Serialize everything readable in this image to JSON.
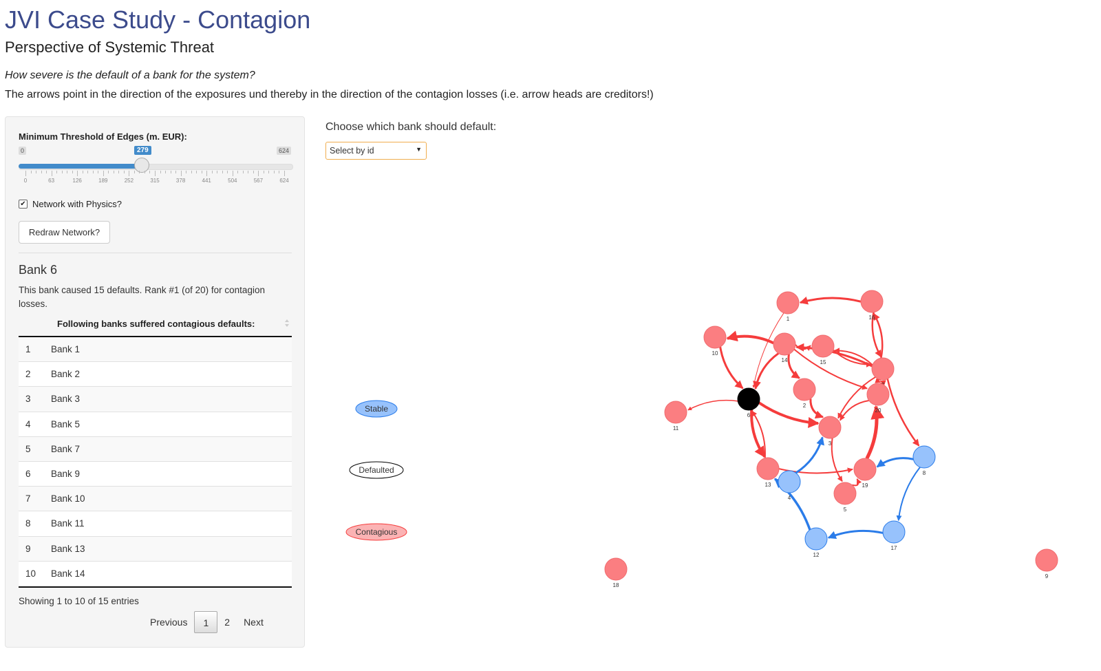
{
  "header": {
    "title": "JVI Case Study - Contagion",
    "subtitle": "Perspective of Systemic Threat",
    "question": "How severe is the default of a bank for the system?",
    "explanation": "The arrows point in the direction of the exposures und thereby in the direction of the contagion losses (i.e. arrow heads are creditors!)"
  },
  "sidebar": {
    "slider": {
      "label": "Minimum Threshold of Edges (m. EUR):",
      "min_label": "0",
      "max_label": "624",
      "value_label": "279",
      "value_fraction": 0.447,
      "tick_labels": [
        "0",
        "63",
        "126",
        "189",
        "252",
        "315",
        "378",
        "441",
        "504",
        "567",
        "624"
      ]
    },
    "physics_checkbox": {
      "label": "Network with Physics?",
      "checked": true,
      "check_glyph": "✔"
    },
    "redraw_button": "Redraw Network?",
    "bank_title": "Bank 6",
    "bank_description": "This bank caused 15 defaults. Rank #1 (of 20) for contagion losses.",
    "table": {
      "header": "Following banks suffered contagious defaults:",
      "rows": [
        {
          "n": "1",
          "name": "Bank 1"
        },
        {
          "n": "2",
          "name": "Bank 2"
        },
        {
          "n": "3",
          "name": "Bank 3"
        },
        {
          "n": "4",
          "name": "Bank 5"
        },
        {
          "n": "5",
          "name": "Bank 7"
        },
        {
          "n": "6",
          "name": "Bank 9"
        },
        {
          "n": "7",
          "name": "Bank 10"
        },
        {
          "n": "8",
          "name": "Bank 11"
        },
        {
          "n": "9",
          "name": "Bank 13"
        },
        {
          "n": "10",
          "name": "Bank 14"
        }
      ],
      "info": "Showing 1 to 10 of 15 entries",
      "pager": {
        "previous": "Previous",
        "page1": "1",
        "page2": "2",
        "next": "Next"
      }
    }
  },
  "main": {
    "choose_label": "Choose which bank should default:",
    "select_value": "Select by id",
    "select_caret": "▼"
  },
  "network": {
    "colors": {
      "stable": "#97c2fc",
      "stable_border": "#2b7ce9",
      "contagious": "#fb7e81",
      "contagious_edge": "#f53c3c",
      "stable_edge": "#2b7ce9",
      "defaulted": "#000000"
    },
    "legend": {
      "stable": "Stable",
      "defaulted": "Defaulted",
      "contagious": "Contagious"
    },
    "nodes": [
      {
        "id": "1",
        "label": "1",
        "group": "contagious"
      },
      {
        "id": "16",
        "label": "16",
        "group": "contagious"
      },
      {
        "id": "10",
        "label": "10",
        "group": "contagious"
      },
      {
        "id": "14",
        "label": "14",
        "group": "contagious"
      },
      {
        "id": "15",
        "label": "15",
        "group": "contagious"
      },
      {
        "id": "7",
        "label": "7",
        "group": "contagious"
      },
      {
        "id": "2",
        "label": "2",
        "group": "contagious"
      },
      {
        "id": "20",
        "label": "20",
        "group": "contagious"
      },
      {
        "id": "6",
        "label": "6",
        "group": "defaulted"
      },
      {
        "id": "11",
        "label": "11",
        "group": "contagious"
      },
      {
        "id": "3",
        "label": "3",
        "group": "contagious"
      },
      {
        "id": "13",
        "label": "13",
        "group": "contagious"
      },
      {
        "id": "4",
        "label": "4",
        "group": "stable"
      },
      {
        "id": "19",
        "label": "19",
        "group": "contagious"
      },
      {
        "id": "8",
        "label": "8",
        "group": "stable"
      },
      {
        "id": "5",
        "label": "5",
        "group": "contagious"
      },
      {
        "id": "12",
        "label": "12",
        "group": "stable"
      },
      {
        "id": "17",
        "label": "17",
        "group": "stable"
      },
      {
        "id": "18",
        "label": "18",
        "group": "contagious"
      },
      {
        "id": "9",
        "label": "9",
        "group": "contagious"
      }
    ],
    "edges": [
      {
        "from": "16",
        "to": "1",
        "w": 3
      },
      {
        "from": "14",
        "to": "10",
        "w": 4
      },
      {
        "from": "1",
        "to": "6",
        "w": 1
      },
      {
        "from": "10",
        "to": "6",
        "w": 3
      },
      {
        "from": "14",
        "to": "6",
        "w": 3
      },
      {
        "from": "6",
        "to": "11",
        "w": 1.5
      },
      {
        "from": "6",
        "to": "3",
        "w": 4
      },
      {
        "from": "6",
        "to": "13",
        "w": 4
      },
      {
        "from": "13",
        "to": "6",
        "w": 2
      },
      {
        "from": "14",
        "to": "2",
        "w": 3
      },
      {
        "from": "2",
        "to": "3",
        "w": 3
      },
      {
        "from": "14",
        "to": "15",
        "w": 2
      },
      {
        "from": "15",
        "to": "7",
        "w": 2
      },
      {
        "from": "7",
        "to": "15",
        "w": 2
      },
      {
        "from": "7",
        "to": "14",
        "w": 3
      },
      {
        "from": "7",
        "to": "16",
        "w": 2.5
      },
      {
        "from": "16",
        "to": "7",
        "w": 2.5
      },
      {
        "from": "14",
        "to": "20",
        "w": 2
      },
      {
        "from": "7",
        "to": "3",
        "w": 2
      },
      {
        "from": "20",
        "to": "3",
        "w": 2
      },
      {
        "from": "3",
        "to": "5",
        "w": 2
      },
      {
        "from": "13",
        "to": "19",
        "w": 2
      },
      {
        "from": "19",
        "to": "20",
        "w": 5
      },
      {
        "from": "5",
        "to": "19",
        "w": 2
      },
      {
        "from": "7",
        "to": "8",
        "w": 2.5
      },
      {
        "from": "8",
        "to": "19",
        "w": 3,
        "stable": true
      },
      {
        "from": "8",
        "to": "17",
        "w": 2,
        "stable": true
      },
      {
        "from": "17",
        "to": "12",
        "w": 3,
        "stable": true
      },
      {
        "from": "12",
        "to": "13",
        "w": 3.5,
        "stable": true
      },
      {
        "from": "4",
        "to": "3",
        "w": 3,
        "stable": true
      },
      {
        "from": "7",
        "to": "20",
        "w": 2
      },
      {
        "from": "20",
        "to": "7",
        "w": 2
      }
    ]
  }
}
